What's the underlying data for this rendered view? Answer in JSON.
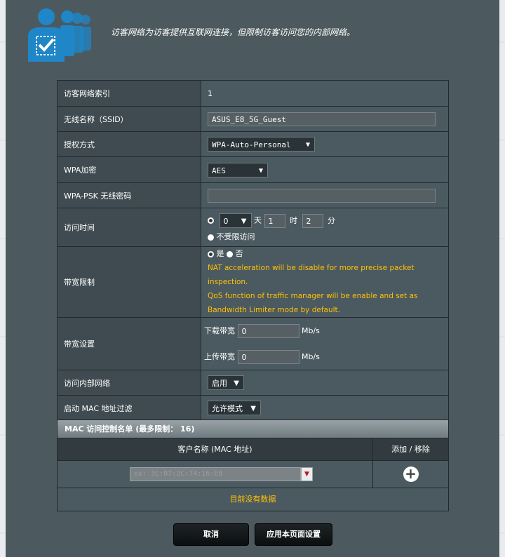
{
  "header": {
    "description": "访客网络为访客提供互联网连接，但限制访客访问您的内部网络。",
    "icon": "guest-network-users-checkbox-icon"
  },
  "settings": {
    "index": {
      "label": "访客网络索引",
      "value": "1"
    },
    "ssid": {
      "label": "无线名称（SSID）",
      "value": "ASUS_E8_5G_Guest"
    },
    "auth": {
      "label": "授权方式",
      "value": "WPA-Auto-Personal"
    },
    "encryption": {
      "label": "WPA加密",
      "value": "AES"
    },
    "psk": {
      "label": "WPA-PSK 无线密码",
      "value": ""
    },
    "access_time": {
      "label": "访问时间",
      "days": "0",
      "days_unit": "天",
      "hours": "1",
      "hours_unit": "时",
      "minutes": "2",
      "minutes_unit": "分",
      "unlimited_label": "不受限访问"
    },
    "bandwidth_limit": {
      "label": "带宽限制",
      "yes": "是",
      "no": "否",
      "note_1": "NAT acceleration will be disable for more precise packet inspection.",
      "note_2": "QoS function of traffic manager will be enable and set as Bandwidth Limiter mode by default."
    },
    "bandwidth_setting": {
      "label": "带宽设置",
      "download_label": "下载带宽",
      "download_value": "0",
      "upload_label": "上传带宽",
      "upload_value": "0",
      "unit": "Mb/s"
    },
    "intranet": {
      "label": "访问内部网络",
      "value": "启用"
    },
    "mac_filter": {
      "label": "启动 MAC 地址过滤",
      "value": "允许模式"
    }
  },
  "mac_list": {
    "title": "MAC 访问控制名单 (最多限制： 16)",
    "col_client": "客户名称 (MAC 地址)",
    "col_action": "添加 / 移除",
    "input_placeholder": "ex: 3C:07:2C:74:16:E8",
    "empty_text": "目前没有数据"
  },
  "buttons": {
    "cancel": "取消",
    "apply": "应用本页面设置"
  },
  "colors": {
    "panel": "#4c5a5f",
    "accent_orange": "#ffc107",
    "label_bg": "#3f4b50"
  }
}
